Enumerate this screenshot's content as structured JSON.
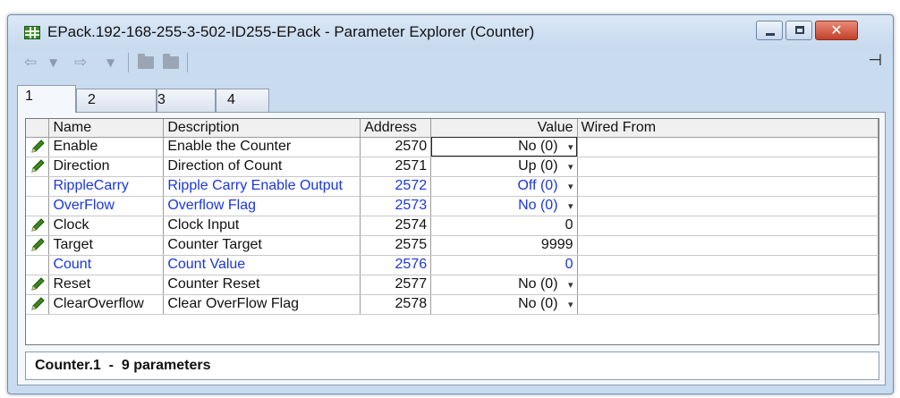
{
  "window": {
    "title": "EPack.192-168-255-3-502-ID255-EPack - Parameter Explorer (Counter)"
  },
  "toolbar": {
    "back_icon": "back-arrow-icon",
    "forward_icon": "forward-arrow-icon",
    "dropdown_glyph": "▾"
  },
  "tabs": [
    {
      "label": "1"
    },
    {
      "label": "2"
    },
    {
      "label": "3"
    },
    {
      "label": "4"
    }
  ],
  "table": {
    "headers": {
      "name": "Name",
      "description": "Description",
      "address": "Address",
      "value": "Value",
      "wired_from": "Wired From"
    },
    "rows": [
      {
        "editable": true,
        "blue": false,
        "name": "Enable",
        "description": "Enable the Counter",
        "address": "2570",
        "value": "No (0)",
        "dropdown": true
      },
      {
        "editable": true,
        "blue": false,
        "name": "Direction",
        "description": "Direction of Count",
        "address": "2571",
        "value": "Up (0)",
        "dropdown": true
      },
      {
        "editable": false,
        "blue": true,
        "name": "RippleCarry",
        "description": "Ripple Carry Enable Output",
        "address": "2572",
        "value": "Off (0)",
        "dropdown": true
      },
      {
        "editable": false,
        "blue": true,
        "name": "OverFlow",
        "description": "Overflow Flag",
        "address": "2573",
        "value": "No (0)",
        "dropdown": true
      },
      {
        "editable": true,
        "blue": false,
        "name": "Clock",
        "description": "Clock Input",
        "address": "2574",
        "value": "0",
        "dropdown": false
      },
      {
        "editable": true,
        "blue": false,
        "name": "Target",
        "description": "Counter Target",
        "address": "2575",
        "value": "9999",
        "dropdown": false
      },
      {
        "editable": false,
        "blue": true,
        "name": "Count",
        "description": "Count Value",
        "address": "2576",
        "value": "0",
        "dropdown": false
      },
      {
        "editable": true,
        "blue": false,
        "name": "Reset",
        "description": "Counter Reset",
        "address": "2577",
        "value": "No (0)",
        "dropdown": true
      },
      {
        "editable": true,
        "blue": false,
        "name": "ClearOverflow",
        "description": "Clear OverFlow Flag",
        "address": "2578",
        "value": "No (0)",
        "dropdown": true
      }
    ]
  },
  "status": {
    "text": "Counter.1  -  9 parameters"
  },
  "colors": {
    "readonly_text": "#1a36e0",
    "pencil": "#3a8a1c"
  }
}
